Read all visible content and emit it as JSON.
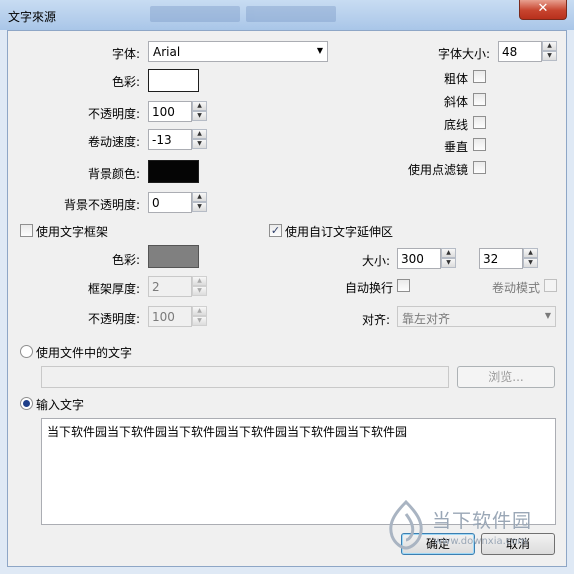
{
  "window": {
    "title": "文字來源",
    "close_glyph": "✕"
  },
  "labels": {
    "font": "字体:",
    "color": "色彩:",
    "opacity": "不透明度:",
    "scroll_speed": "卷动速度:",
    "bg_color": "背景颜色:",
    "bg_opacity": "背景不透明度:",
    "font_size": "字体大小:",
    "bold": "粗体",
    "italic": "斜体",
    "underline": "底线",
    "vertical": "垂直",
    "use_point_filter": "使用点滤镜",
    "use_text_frame": "使用文字框架",
    "frame_color": "色彩:",
    "frame_thickness": "框架厚度:",
    "frame_opacity": "不透明度:",
    "use_custom_extent": "使用自订文字延伸区",
    "size": "大小:",
    "word_wrap": "自动换行",
    "scroll_mode": "卷动模式",
    "align": "对齐:",
    "use_file_text": "使用文件中的文字",
    "browse": "浏览...",
    "input_text": "输入文字",
    "ok": "确定",
    "cancel": "取消"
  },
  "values": {
    "font": "Arial",
    "font_size": "48",
    "opacity": "100",
    "scroll_speed": "-13",
    "bg_opacity": "0",
    "frame_thickness": "2",
    "frame_opacity": "100",
    "size_w": "300",
    "size_h": "32",
    "align": "靠左对齐",
    "file_path": "",
    "text": "当下软件园当下软件园当下软件园当下软件园当下软件园当下软件园"
  },
  "state": {
    "bold": false,
    "italic": false,
    "underline": false,
    "vertical": false,
    "use_point_filter": false,
    "use_text_frame": false,
    "use_custom_extent": true,
    "word_wrap": false,
    "scroll_mode": false,
    "source": "input_text"
  },
  "colors": {
    "text_color": "#ffffff",
    "bg_color": "#050505",
    "frame_color": "#808080",
    "accent": "#3c7fb1"
  },
  "glyphs": {
    "check": "✓",
    "up": "▲",
    "down": "▼",
    "dropdown": "▼"
  },
  "watermark": {
    "name": "当下软件园",
    "url": "www.downxia.com"
  }
}
